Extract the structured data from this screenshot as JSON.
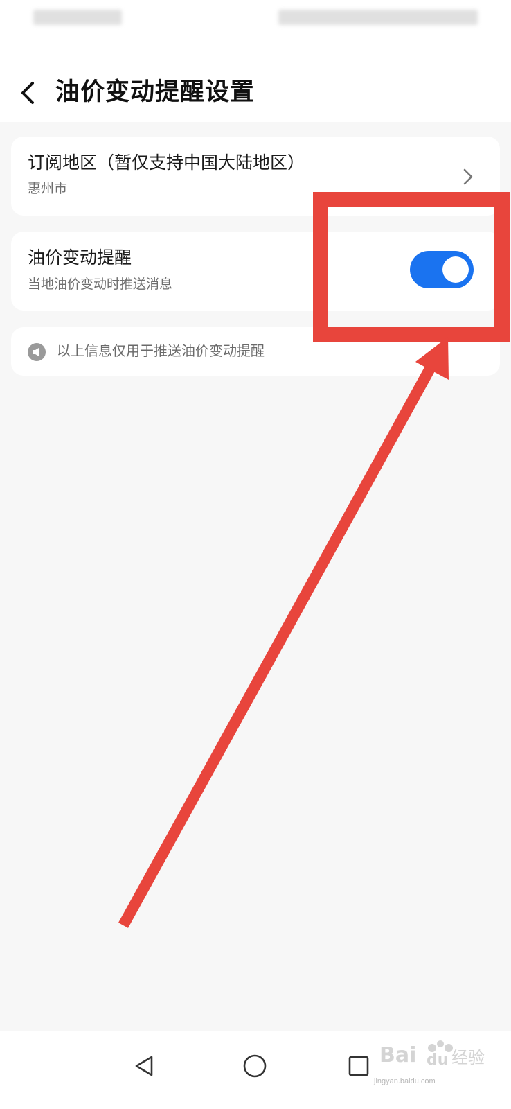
{
  "header": {
    "title": "油价变动提醒设置"
  },
  "subscription_card": {
    "title": "订阅地区（暂仅支持中国大陆地区）",
    "value": "惠州市"
  },
  "reminder_card": {
    "title": "油价变动提醒",
    "subtitle": "当地油价变动时推送消息",
    "toggle_on": true
  },
  "info_card": {
    "text": "以上信息仅用于推送油价变动提醒"
  },
  "colors": {
    "accent": "#1a73f0",
    "annotation": "#e8453c",
    "background": "#f7f7f7"
  },
  "icons": {
    "back": "back-chevron-icon",
    "chevron": "chevron-right-icon",
    "info": "megaphone-icon",
    "nav_back": "triangle-back-icon",
    "nav_home": "circle-home-icon",
    "nav_recent": "square-recents-icon"
  },
  "watermark": {
    "logo": "Baidu经验",
    "url": "jingyan.baidu.com"
  }
}
